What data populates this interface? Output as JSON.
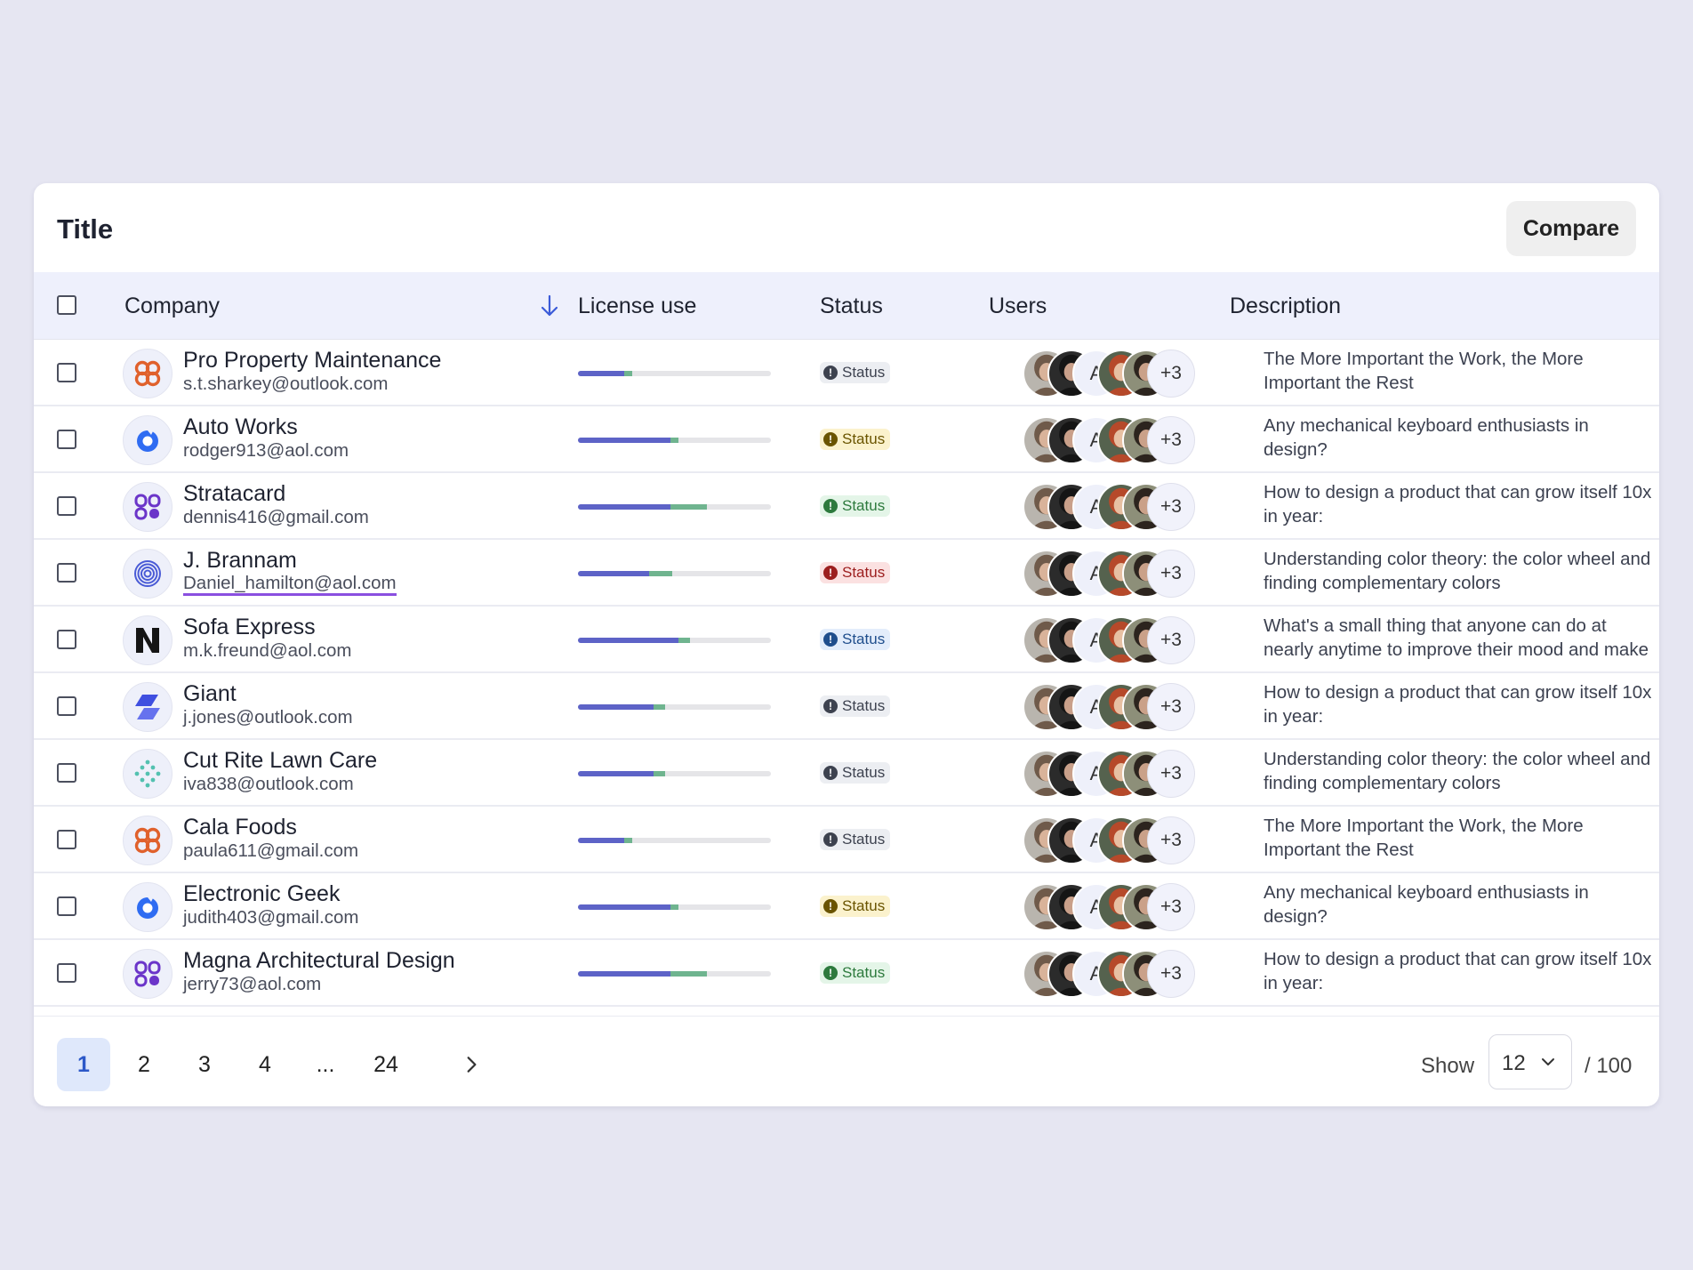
{
  "card": {
    "title": "Title",
    "compare_label": "Compare"
  },
  "columns": {
    "company": "Company",
    "license": "License use",
    "status": "Status",
    "users": "Users",
    "description": "Description"
  },
  "colors": {
    "bar_primary": "#5d63c7",
    "bar_secondary": "#6fb48f",
    "underline": "#8a4fe0",
    "page_active_bg": "#dfe8fb"
  },
  "rows": [
    {
      "name": "Pro Property Maintenance",
      "email": "s.t.sharkey@outlook.com",
      "logo": "flower-logo-icon",
      "license": [
        0.24,
        0.04
      ],
      "status": {
        "label": "Status",
        "variant": "neutral",
        "icon": "alert-circle-icon"
      },
      "users": {
        "letter": "A",
        "more": "+3"
      },
      "description": "The More Important the Work, the More Important the Rest"
    },
    {
      "name": "Auto Works",
      "email": "rodger913@aol.com",
      "logo": "ring-logo-icon",
      "license": [
        0.48,
        0.04
      ],
      "status": {
        "label": "Status",
        "variant": "warn",
        "icon": "alert-circle-icon"
      },
      "users": {
        "letter": "A",
        "more": "+3"
      },
      "description": "Any mechanical keyboard enthusiasts in design?"
    },
    {
      "name": "Stratacard",
      "email": "dennis416@gmail.com",
      "logo": "blocks-logo-icon",
      "license": [
        0.48,
        0.19
      ],
      "status": {
        "label": "Status",
        "variant": "ok",
        "icon": "alert-circle-icon"
      },
      "users": {
        "letter": "A",
        "more": "+3"
      },
      "description": "How to design a product that can grow itself 10x in year:"
    },
    {
      "name": "J. Brannam",
      "email": "Daniel_hamilton@aol.com",
      "logo": "spiral-logo-icon",
      "license": [
        0.37,
        0.12
      ],
      "status": {
        "label": "Status",
        "variant": "err",
        "icon": "alert-circle-icon"
      },
      "users": {
        "letter": "A",
        "more": "+3"
      },
      "description": "Understanding color theory: the color wheel and finding complementary colors"
    },
    {
      "name": "Sofa Express",
      "email": "m.k.freund@aol.com",
      "logo": "n-logo-icon",
      "license": [
        0.52,
        0.06
      ],
      "status": {
        "label": "Status",
        "variant": "info",
        "icon": "alert-circle-icon"
      },
      "users": {
        "letter": "A",
        "more": "+3"
      },
      "description": "What's a small thing that anyone can do at nearly anytime to improve their mood and make"
    },
    {
      "name": "Giant",
      "email": "j.jones@outlook.com",
      "logo": "slash-logo-icon",
      "license": [
        0.39,
        0.06
      ],
      "status": {
        "label": "Status",
        "variant": "neutral",
        "icon": "alert-circle-icon"
      },
      "users": {
        "letter": "A",
        "more": "+3"
      },
      "description": "How to design a product that can grow itself 10x in year:"
    },
    {
      "name": "Cut Rite Lawn Care",
      "email": "iva838@outlook.com",
      "logo": "dots-logo-icon",
      "license": [
        0.39,
        0.06
      ],
      "status": {
        "label": "Status",
        "variant": "neutral",
        "icon": "alert-circle-icon"
      },
      "users": {
        "letter": "A",
        "more": "+3"
      },
      "description": "Understanding color theory: the color wheel and finding complementary colors"
    },
    {
      "name": "Cala Foods",
      "email": "paula611@gmail.com",
      "logo": "flower-logo-icon",
      "license": [
        0.24,
        0.04
      ],
      "status": {
        "label": "Status",
        "variant": "neutral",
        "icon": "alert-circle-icon"
      },
      "users": {
        "letter": "A",
        "more": "+3"
      },
      "description": "The More Important the Work, the More Important the Rest"
    },
    {
      "name": "Electronic Geek",
      "email": "judith403@gmail.com",
      "logo": "ring-logo-icon",
      "license": [
        0.48,
        0.04
      ],
      "status": {
        "label": "Status",
        "variant": "warn",
        "icon": "alert-circle-icon"
      },
      "users": {
        "letter": "A",
        "more": "+3"
      },
      "description": "Any mechanical keyboard enthusiasts in design?"
    },
    {
      "name": "Magna Architectural Design",
      "email": "jerry73@aol.com",
      "logo": "blocks-logo-icon",
      "license": [
        0.48,
        0.19
      ],
      "status": {
        "label": "Status",
        "variant": "ok",
        "icon": "alert-circle-icon"
      },
      "users": {
        "letter": "A",
        "more": "+3"
      },
      "description": "How to design a product that can grow itself 10x in year:"
    }
  ],
  "pagination": {
    "pages": [
      "1",
      "2",
      "3",
      "4",
      "...",
      "24"
    ],
    "current": "1",
    "show_label": "Show",
    "page_size": "12",
    "total": "/ 100"
  }
}
